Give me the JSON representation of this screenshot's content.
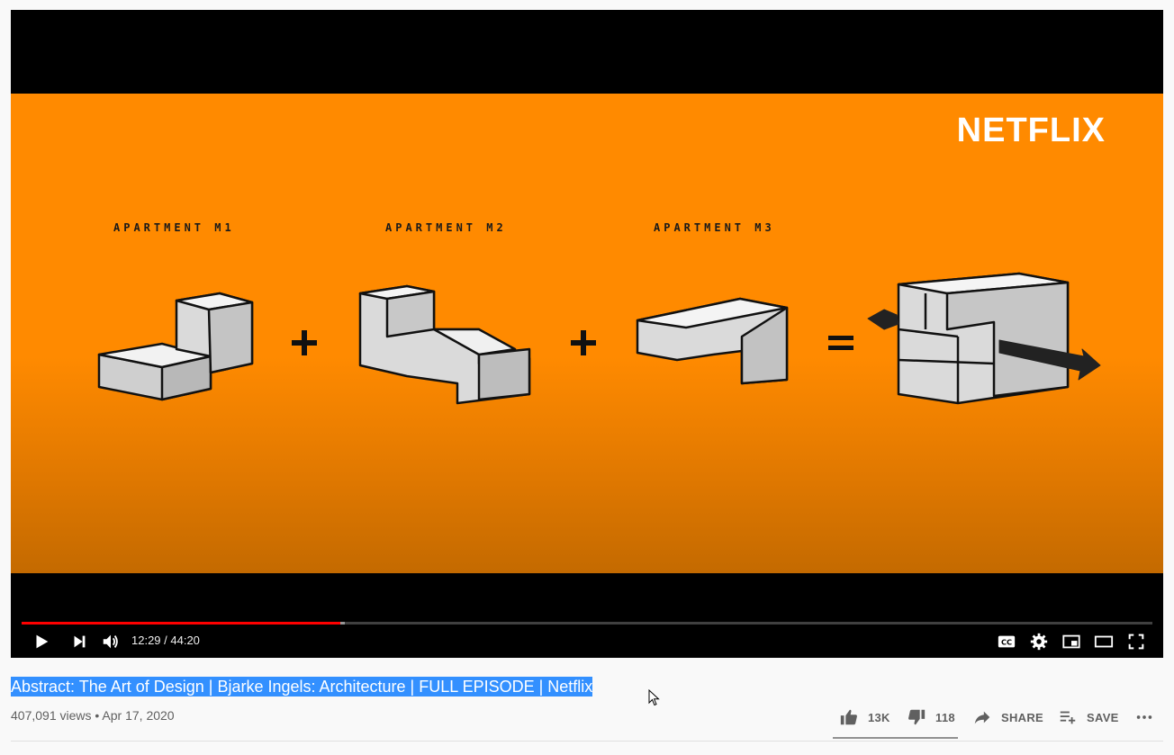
{
  "player": {
    "brand": "NETFLIX",
    "apartments": [
      "APARTMENT M1",
      "APARTMENT M2",
      "APARTMENT M3"
    ],
    "operators": [
      "+",
      "+",
      "="
    ],
    "time_display": "12:29 / 44:20",
    "progress_played_fraction": 0.282,
    "progress_loaded_fraction": 0.286,
    "icons": {
      "play": "play-icon",
      "next": "next-icon",
      "volume": "volume-icon",
      "captions": "captions-icon",
      "settings": "gear-icon",
      "miniplayer": "miniplayer-icon",
      "theater": "theater-icon",
      "fullscreen": "fullscreen-icon"
    }
  },
  "video": {
    "title": "Abstract: The Art of Design | Bjarke Ingels: Architecture | FULL EPISODE | Netflix",
    "meta": "407,091 views • Apr 17, 2020",
    "likes": "13K",
    "dislikes": "118",
    "share_label": "SHARE",
    "save_label": "SAVE"
  },
  "colors": {
    "progress": "#ff0000",
    "frame_orange": "#ff8a00",
    "title_highlight": "#3390ff"
  }
}
